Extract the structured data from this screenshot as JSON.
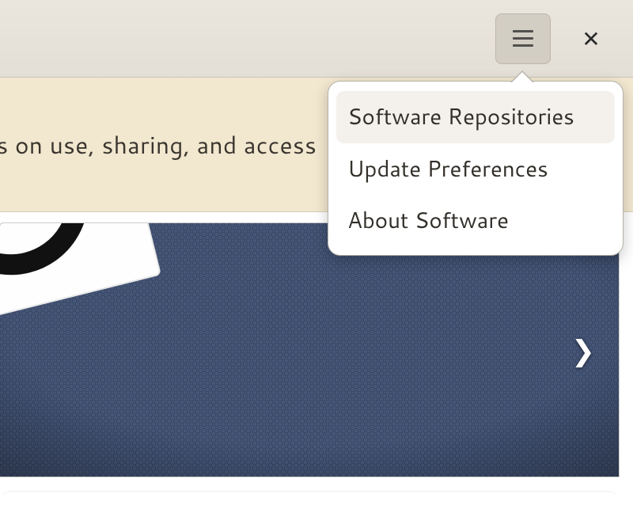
{
  "header": {
    "hamburger_button": "Menu",
    "close_button": "Close"
  },
  "infobar": {
    "message_fragment": "ons on use, sharing, and access"
  },
  "menu": {
    "items": [
      {
        "label": "Software Repositories",
        "selected": true
      },
      {
        "label": "Update Preferences",
        "selected": false
      },
      {
        "label": "About Software",
        "selected": false
      }
    ]
  },
  "carousel": {
    "next_symbol": "❯"
  }
}
